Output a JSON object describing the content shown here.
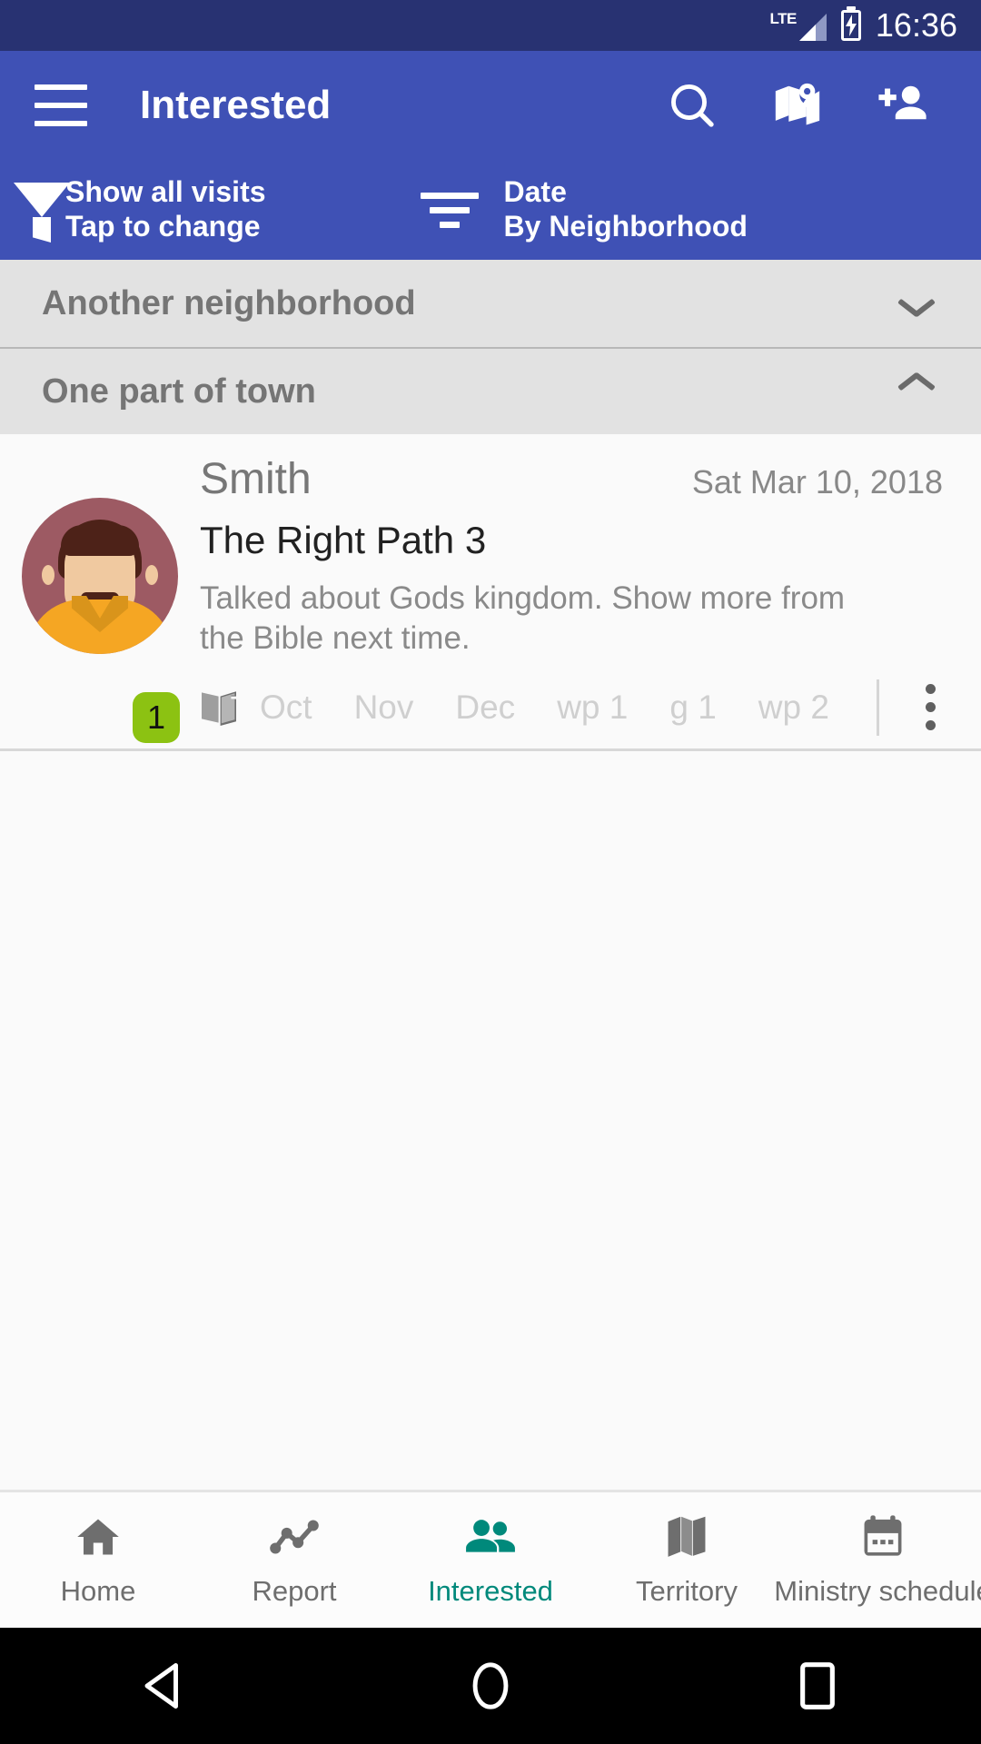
{
  "status_bar": {
    "network_label": "LTE",
    "time": "16:36",
    "battery_state": "charging",
    "signal_icon": "signal-bars-icon",
    "battery_icon": "battery-charging-icon"
  },
  "app_bar": {
    "menu_icon": "hamburger-menu-icon",
    "title": "Interested",
    "actions": [
      {
        "name": "search-icon",
        "label": "Search"
      },
      {
        "name": "map-pin-icon",
        "label": "Map"
      },
      {
        "name": "add-person-icon",
        "label": "Add person"
      }
    ],
    "background_color": "#3f51b5"
  },
  "filter_bar": {
    "filter": {
      "icon": "funnel-filter-icon",
      "primary": "Show all visits",
      "secondary": "Tap to change"
    },
    "sort": {
      "icon": "sort-lines-icon",
      "primary": "Date",
      "secondary": "By Neighborhood"
    }
  },
  "groups": [
    {
      "title": "Another neighborhood",
      "expanded": false,
      "chevron": "chevron-down-icon"
    },
    {
      "title": "One part of town",
      "expanded": true,
      "chevron": "chevron-up-icon"
    }
  ],
  "contacts": [
    {
      "name": "Smith",
      "date": "Sat Mar 10, 2018",
      "subtitle": "The Right Path 3",
      "note": "Talked about Gods kingdom. Show more from the Bible next time.",
      "badge_count": "1",
      "badge_color": "#8cc212",
      "avatar_icon": "avatar-man-icon",
      "publication_icon": "open-book-icon",
      "tags": [
        "Oct",
        "Nov",
        "Dec",
        "wp 1",
        "g 1",
        "wp 2"
      ],
      "overflow_icon": "overflow-menu-icon"
    }
  ],
  "bottom_nav": {
    "active_color": "#00897b",
    "inactive_color": "#6e6e6e",
    "items": [
      {
        "label": "Home",
        "icon": "home-icon",
        "active": false
      },
      {
        "label": "Report",
        "icon": "line-chart-icon",
        "active": false
      },
      {
        "label": "Interested",
        "icon": "people-icon",
        "active": true
      },
      {
        "label": "Territory",
        "icon": "folded-map-icon",
        "active": false
      },
      {
        "label": "Ministry schedule",
        "icon": "calendar-icon",
        "active": false
      }
    ]
  },
  "android_nav": {
    "buttons": [
      {
        "name": "back-button",
        "icon": "back-triangle-icon"
      },
      {
        "name": "home-button",
        "icon": "home-circle-icon"
      },
      {
        "name": "recents-button",
        "icon": "recents-square-icon"
      }
    ]
  }
}
